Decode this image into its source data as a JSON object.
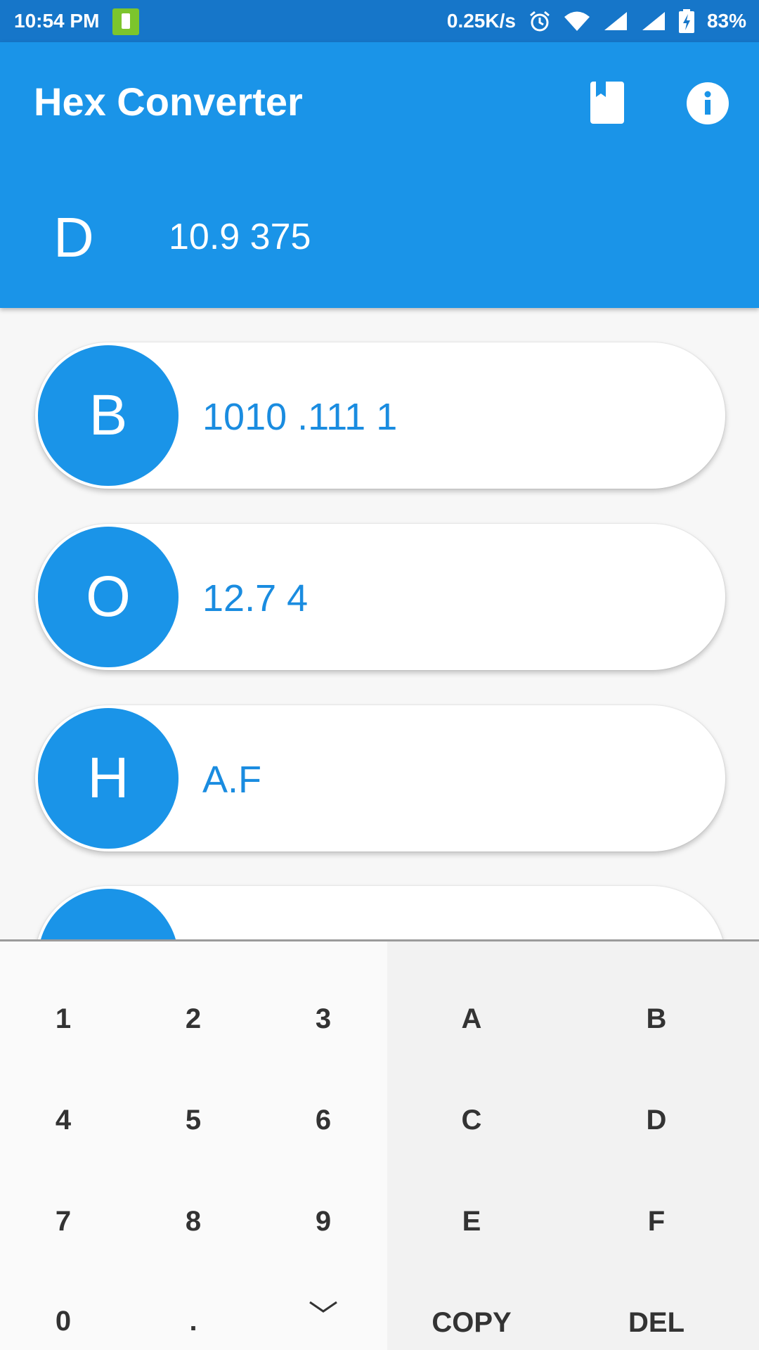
{
  "status_bar": {
    "time": "10:54 PM",
    "speed": "0.25K/s",
    "battery": "83%",
    "icons": [
      "battery-saver-icon",
      "alarm-icon",
      "wifi-icon",
      "signal-icon",
      "signal-icon",
      "battery-charging-icon"
    ]
  },
  "app": {
    "title": "Hex Converter",
    "actions": [
      "bookmark-icon",
      "info-icon"
    ]
  },
  "decimal": {
    "letter": "D",
    "value": "10.9 375"
  },
  "conversions": [
    {
      "letter": "B",
      "value": "1010 .111 1"
    },
    {
      "letter": "O",
      "value": "12.7 4"
    },
    {
      "letter": "H",
      "value": "A.F"
    }
  ],
  "keypad": {
    "numeric": [
      "1",
      "2",
      "3",
      "4",
      "5",
      "6",
      "7",
      "8",
      "9",
      "0",
      "."
    ],
    "hex": [
      "A",
      "B",
      "C",
      "D",
      "E",
      "F"
    ],
    "copy": "COPY",
    "delete": "DEL",
    "collapse_icon": "chevron-down-icon"
  },
  "colors": {
    "primary": "#1a94e8",
    "status_bar": "#1676c9",
    "value_text": "#1a8ce0",
    "battery_saver": "#7cc52c"
  }
}
